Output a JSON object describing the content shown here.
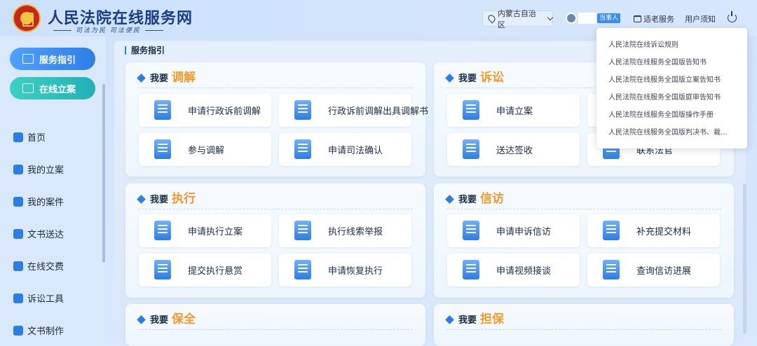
{
  "header": {
    "title": "人民法院在线服务网",
    "subtitle": "司法为民  司法便民",
    "region": "内蒙古自治区",
    "role_badge": "当事人",
    "elder_mode": "适老服务",
    "notice": "用户须知"
  },
  "dropdown": [
    "人民法院在线诉讼规则",
    "人民法院在线服务全国版告知书",
    "人民法院在线服务全国版立案告知书",
    "人民法院在线服务全国版庭审告知书",
    "人民法院在线服务全国版操作手册",
    "人民法院在线服务全国版判决书、裁..."
  ],
  "sidebar": {
    "primary": [
      "服务指引",
      "在线立案"
    ],
    "items": [
      "首页",
      "我的立案",
      "我的案件",
      "文书送达",
      "在线交费",
      "诉讼工具",
      "文书制作"
    ]
  },
  "breadcrumb": "服务指引",
  "cards": [
    {
      "pre": "我要",
      "kw": "调解",
      "services": [
        "申请行政诉前调解",
        "行政诉前调解出具调解书",
        "参与调解",
        "申请司法确认"
      ]
    },
    {
      "pre": "我要",
      "kw": "诉讼",
      "services": [
        "申请立案",
        "",
        "送达签收",
        "联系法官"
      ]
    },
    {
      "pre": "我要",
      "kw": "执行",
      "services": [
        "申请执行立案",
        "执行线索举报",
        "提交执行悬赏",
        "申请恢复执行"
      ]
    },
    {
      "pre": "我要",
      "kw": "信访",
      "services": [
        "申请申诉信访",
        "补充提交材料",
        "申请视频接谈",
        "查询信访进展"
      ]
    },
    {
      "pre": "我要",
      "kw": "保全",
      "services": []
    },
    {
      "pre": "我要",
      "kw": "担保",
      "services": []
    }
  ]
}
